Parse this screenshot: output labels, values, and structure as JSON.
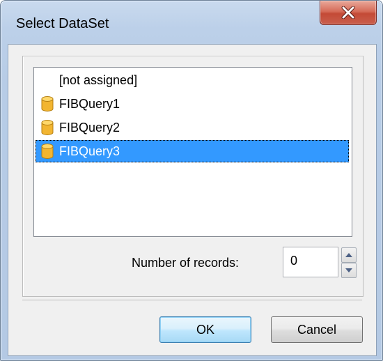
{
  "window": {
    "title": "Select DataSet"
  },
  "dataset_list": {
    "items": [
      {
        "label": "[not assigned]",
        "icon": null,
        "selected": false
      },
      {
        "label": "FIBQuery1",
        "icon": "database-icon",
        "selected": false
      },
      {
        "label": "FIBQuery2",
        "icon": "database-icon",
        "selected": false
      },
      {
        "label": "FIBQuery3",
        "icon": "database-icon",
        "selected": true
      }
    ]
  },
  "records": {
    "label": "Number of records:",
    "value": "0"
  },
  "buttons": {
    "ok": "OK",
    "cancel": "Cancel"
  },
  "colors": {
    "selection": "#3399ff",
    "close_button": "#c44a36",
    "db_icon": "#f2b531"
  }
}
